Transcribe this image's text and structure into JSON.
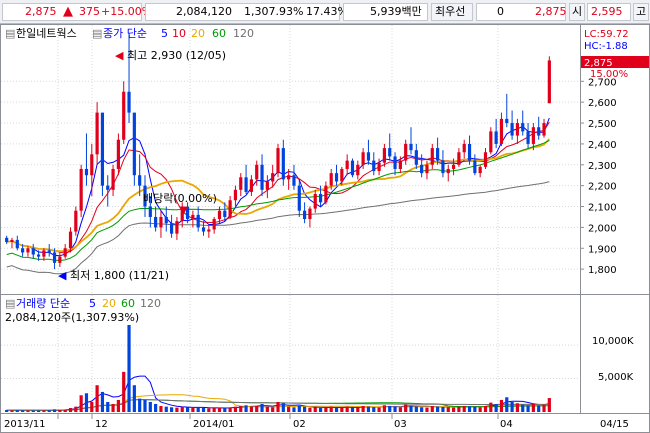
{
  "top_bar": {
    "price": "2,875",
    "change": "375",
    "change_pct": "+15.00%",
    "volume": "2,084,120",
    "volume_ratio": "1,307.93%",
    "turnover_pct": "17.43%",
    "amount": "5,939백만",
    "pref_label": "최우선",
    "pref_value": "0",
    "ask_price": "2,875",
    "open_label": "시",
    "open_value": "2,595",
    "high_label": "고"
  },
  "price_panel": {
    "stock_name": "한일네트웍스",
    "ma_label": "종가 단순",
    "ma_periods": [
      "5",
      "10",
      "20",
      "60",
      "120"
    ],
    "ma_colors": [
      "#0000ff",
      "#e0001b",
      "#e8a800",
      "#009a00",
      "#707070"
    ],
    "lc": "LC:59.72",
    "hc": "HC:-1.88",
    "current_price_tag": "2,875",
    "current_pct_tag": "15.00%",
    "high_annotation": "최고 2,930 (12/05)",
    "low_annotation": "최저 1,800 (11/21)",
    "dividend_annotation": "배당락(0.00%)",
    "y_ticks": [
      "2,700",
      "2,600",
      "2,500",
      "2,400",
      "2,300",
      "2,200",
      "2,100",
      "2,000",
      "1,900",
      "1,800"
    ]
  },
  "volume_panel": {
    "label": "거래량 단순",
    "ma_periods": [
      "5",
      "20",
      "60",
      "120"
    ],
    "ma_colors": [
      "#0000ff",
      "#e8a800",
      "#009a00",
      "#707070"
    ],
    "value_readout": "2,084,120주(1,307.93%)",
    "y_ticks": [
      "10,000K",
      "5,000K"
    ]
  },
  "x_axis": {
    "labels": [
      "2013/11",
      "12",
      "2014/01",
      "02",
      "03",
      "04",
      "04/15"
    ]
  },
  "chart_data": {
    "type": "candlestick",
    "price_range": [
      1700,
      2850
    ],
    "volume_range": [
      0,
      13000
    ],
    "volume_unit": "K",
    "candles": [
      [
        1950,
        1960,
        1920,
        1930,
        300
      ],
      [
        1930,
        1950,
        1900,
        1940,
        250
      ],
      [
        1940,
        1960,
        1890,
        1900,
        280
      ],
      [
        1900,
        1920,
        1860,
        1880,
        260
      ],
      [
        1880,
        1910,
        1860,
        1900,
        240
      ],
      [
        1900,
        1920,
        1850,
        1870,
        230
      ],
      [
        1870,
        1890,
        1840,
        1860,
        220
      ],
      [
        1860,
        1900,
        1840,
        1890,
        250
      ],
      [
        1890,
        1920,
        1860,
        1880,
        260
      ],
      [
        1880,
        1900,
        1800,
        1830,
        400
      ],
      [
        1830,
        1880,
        1810,
        1860,
        300
      ],
      [
        1860,
        1920,
        1850,
        1900,
        350
      ],
      [
        1900,
        2000,
        1880,
        1980,
        600
      ],
      [
        1980,
        2100,
        1960,
        2080,
        800
      ],
      [
        2080,
        2300,
        2050,
        2280,
        2500
      ],
      [
        2280,
        2450,
        2200,
        2250,
        2800
      ],
      [
        2250,
        2400,
        2150,
        2350,
        1500
      ],
      [
        2350,
        2600,
        2300,
        2550,
        4000
      ],
      [
        2550,
        2500,
        2150,
        2200,
        3000
      ],
      [
        2200,
        2250,
        2100,
        2180,
        1500
      ],
      [
        2180,
        2300,
        2150,
        2280,
        1200
      ],
      [
        2280,
        2450,
        2250,
        2420,
        1800
      ],
      [
        2420,
        2700,
        2400,
        2650,
        6000
      ],
      [
        2650,
        2930,
        2500,
        2550,
        13000
      ],
      [
        2550,
        2500,
        2200,
        2250,
        4000
      ],
      [
        2250,
        2350,
        2150,
        2200,
        2000
      ],
      [
        2200,
        2250,
        2050,
        2100,
        1800
      ],
      [
        2100,
        2150,
        2000,
        2050,
        1500
      ],
      [
        2050,
        2100,
        1980,
        2000,
        1200
      ],
      [
        2000,
        2080,
        1950,
        2050,
        900
      ],
      [
        2050,
        2100,
        1980,
        2020,
        800
      ],
      [
        2020,
        2060,
        1950,
        1970,
        700
      ],
      [
        1970,
        2050,
        1940,
        2030,
        650
      ],
      [
        2030,
        2120,
        2000,
        2100,
        800
      ],
      [
        2100,
        2120,
        2020,
        2040,
        700
      ],
      [
        2040,
        2080,
        2000,
        2060,
        600
      ],
      [
        2060,
        2100,
        1980,
        2000,
        700
      ],
      [
        2000,
        2030,
        1960,
        1980,
        600
      ],
      [
        1980,
        2010,
        1950,
        1990,
        550
      ],
      [
        1990,
        2050,
        1970,
        2040,
        600
      ],
      [
        2040,
        2100,
        2020,
        2080,
        650
      ],
      [
        2080,
        2120,
        2030,
        2050,
        600
      ],
      [
        2050,
        2150,
        2040,
        2130,
        700
      ],
      [
        2130,
        2200,
        2100,
        2180,
        800
      ],
      [
        2180,
        2260,
        2150,
        2240,
        900
      ],
      [
        2240,
        2300,
        2160,
        2170,
        1000
      ],
      [
        2170,
        2250,
        2150,
        2230,
        800
      ],
      [
        2230,
        2320,
        2200,
        2300,
        900
      ],
      [
        2300,
        2350,
        2150,
        2180,
        1200
      ],
      [
        2180,
        2250,
        2140,
        2220,
        800
      ],
      [
        2220,
        2300,
        2190,
        2260,
        700
      ],
      [
        2260,
        2400,
        2240,
        2380,
        1500
      ],
      [
        2380,
        2420,
        2200,
        2230,
        1300
      ],
      [
        2230,
        2280,
        2180,
        2250,
        800
      ],
      [
        2250,
        2300,
        2180,
        2200,
        700
      ],
      [
        2200,
        2230,
        2050,
        2080,
        900
      ],
      [
        2080,
        2120,
        2020,
        2040,
        800
      ],
      [
        2040,
        2100,
        2000,
        2090,
        600
      ],
      [
        2090,
        2180,
        2070,
        2160,
        700
      ],
      [
        2160,
        2200,
        2100,
        2120,
        600
      ],
      [
        2120,
        2220,
        2110,
        2200,
        700
      ],
      [
        2200,
        2280,
        2180,
        2260,
        800
      ],
      [
        2260,
        2300,
        2200,
        2220,
        600
      ],
      [
        2220,
        2290,
        2200,
        2280,
        700
      ],
      [
        2280,
        2350,
        2250,
        2320,
        800
      ],
      [
        2320,
        2330,
        2240,
        2250,
        700
      ],
      [
        2250,
        2320,
        2230,
        2300,
        650
      ],
      [
        2300,
        2380,
        2280,
        2360,
        900
      ],
      [
        2360,
        2420,
        2300,
        2320,
        800
      ],
      [
        2320,
        2360,
        2250,
        2270,
        700
      ],
      [
        2270,
        2330,
        2250,
        2310,
        650
      ],
      [
        2310,
        2400,
        2290,
        2380,
        1000
      ],
      [
        2380,
        2450,
        2320,
        2340,
        900
      ],
      [
        2340,
        2360,
        2250,
        2280,
        800
      ],
      [
        2280,
        2340,
        2260,
        2320,
        700
      ],
      [
        2320,
        2420,
        2300,
        2400,
        1100
      ],
      [
        2400,
        2480,
        2350,
        2370,
        1000
      ],
      [
        2370,
        2400,
        2280,
        2300,
        800
      ],
      [
        2300,
        2350,
        2240,
        2260,
        700
      ],
      [
        2260,
        2320,
        2230,
        2300,
        650
      ],
      [
        2300,
        2400,
        2280,
        2380,
        900
      ],
      [
        2380,
        2430,
        2300,
        2320,
        800
      ],
      [
        2320,
        2370,
        2240,
        2260,
        750
      ],
      [
        2260,
        2300,
        2220,
        2280,
        700
      ],
      [
        2280,
        2330,
        2250,
        2300,
        650
      ],
      [
        2300,
        2380,
        2290,
        2360,
        800
      ],
      [
        2360,
        2420,
        2330,
        2400,
        900
      ],
      [
        2400,
        2440,
        2300,
        2320,
        850
      ],
      [
        2320,
        2350,
        2250,
        2260,
        800
      ],
      [
        2260,
        2300,
        2240,
        2290,
        700
      ],
      [
        2290,
        2380,
        2280,
        2360,
        900
      ],
      [
        2360,
        2480,
        2350,
        2460,
        1400
      ],
      [
        2460,
        2520,
        2380,
        2400,
        1200
      ],
      [
        2400,
        2550,
        2390,
        2520,
        1800
      ],
      [
        2520,
        2640,
        2480,
        2500,
        2200
      ],
      [
        2500,
        2560,
        2420,
        2440,
        1500
      ],
      [
        2440,
        2520,
        2400,
        2500,
        1300
      ],
      [
        2500,
        2560,
        2440,
        2460,
        1100
      ],
      [
        2460,
        2500,
        2380,
        2400,
        1000
      ],
      [
        2400,
        2500,
        2370,
        2480,
        1200
      ],
      [
        2480,
        2530,
        2420,
        2440,
        1000
      ],
      [
        2440,
        2520,
        2430,
        2500,
        1100
      ],
      [
        2595,
        2820,
        2595,
        2800,
        2084
      ]
    ]
  }
}
